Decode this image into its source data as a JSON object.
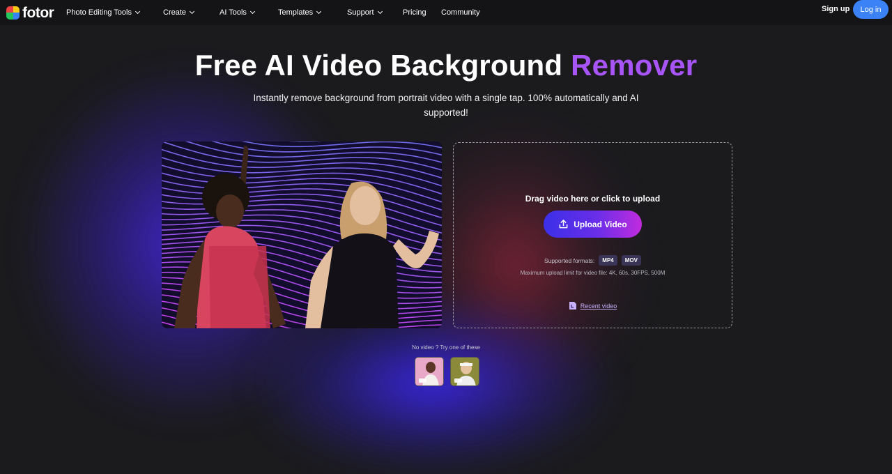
{
  "nav": {
    "logo": "fotor",
    "items": [
      {
        "label": "Photo Editing Tools",
        "dropdown": true
      },
      {
        "label": "Create",
        "dropdown": true
      },
      {
        "label": "AI Tools",
        "dropdown": true
      },
      {
        "label": "Templates",
        "dropdown": true
      },
      {
        "label": "Support",
        "dropdown": true
      },
      {
        "label": "Pricing",
        "dropdown": false
      },
      {
        "label": "Community",
        "dropdown": false
      }
    ],
    "signup": "Sign up",
    "login": "Log in"
  },
  "hero": {
    "title_main": "Free AI Video Background ",
    "title_accent": "Remover",
    "subtitle": "Instantly remove background from portrait video with a single tap. 100% automatically and AI supported!"
  },
  "upload": {
    "drag_text": "Drag video here or click to upload",
    "button_label": "Upload Video",
    "formats_label": "Supported formats:",
    "formats": [
      "MP4",
      "MOV"
    ],
    "limit": "Maximum upload limit for video file: 4K, 60s, 30FPS, 500M",
    "recent": "Recent video"
  },
  "samples": {
    "prompt": "No video ? Try one of these"
  },
  "colors": {
    "accent": "#a855f7",
    "login_bg": "#3b82f6",
    "bg": "#1b1b1e"
  }
}
